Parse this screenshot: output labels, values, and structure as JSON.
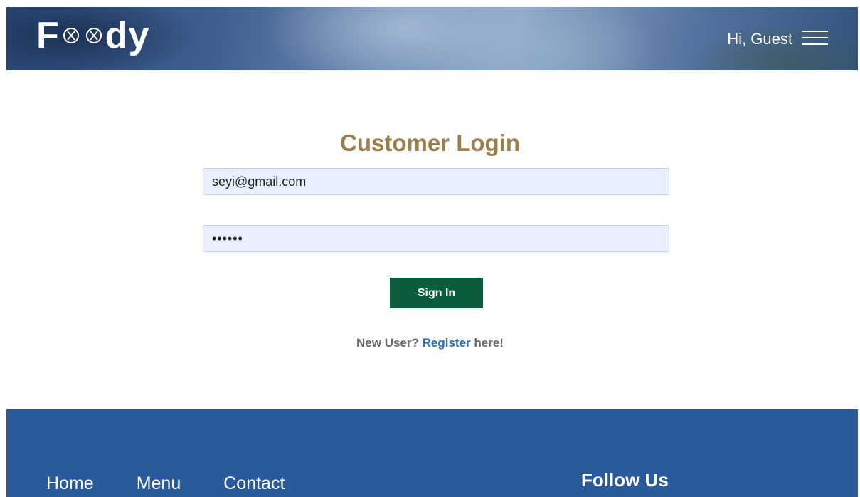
{
  "header": {
    "logo_first": "F",
    "logo_last": "dy",
    "greeting": "Hi, Guest"
  },
  "login": {
    "title": "Customer Login",
    "email_value": "seyi@gmail.com",
    "password_value": "secret",
    "signin_label": "Sign In",
    "new_user_text": "New User?",
    "register_link": "Register",
    "here_text": "here!"
  },
  "footer": {
    "nav": [
      "Home",
      "Menu",
      "Contact"
    ],
    "follow_title": "Follow Us"
  },
  "colors": {
    "title": "#9a7f4a",
    "button": "#0b5d3b",
    "footer": "#285a9c",
    "link": "#2b6cb0"
  }
}
